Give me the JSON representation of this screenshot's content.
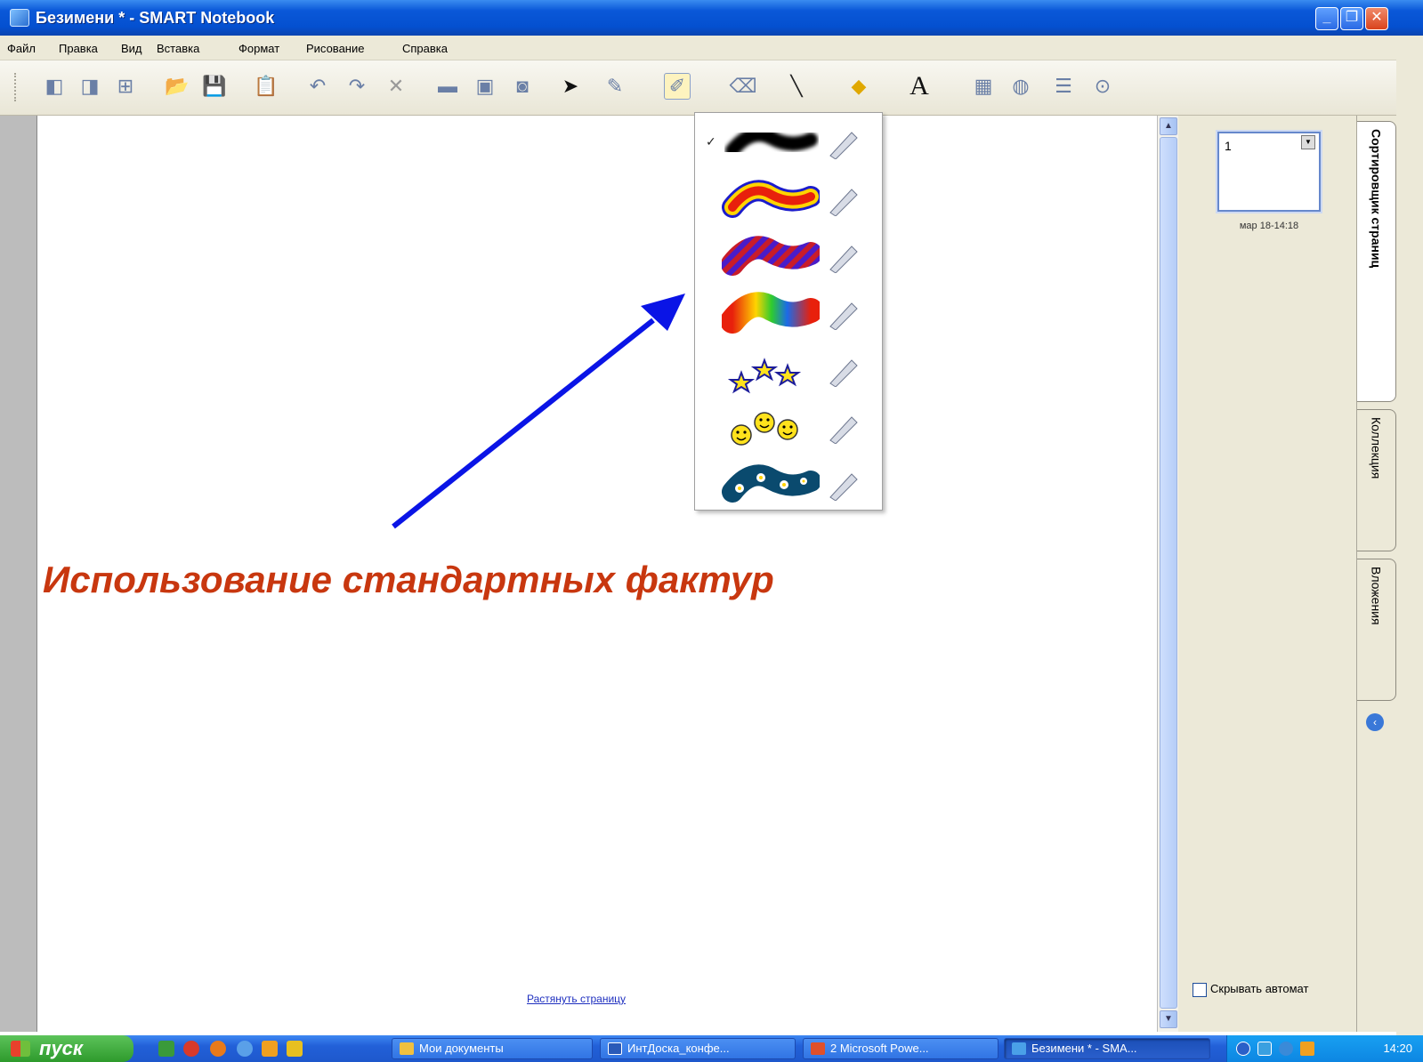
{
  "window": {
    "title": "Безимени * - SMART Notebook"
  },
  "menu": [
    "Файл",
    "Правка",
    "Вид",
    "Вставка",
    "Формат",
    "Рисование",
    "Справка"
  ],
  "toolbar": {
    "icons": [
      "previous-page-icon",
      "next-page-icon",
      "add-page-icon",
      "open-icon",
      "save-icon",
      "paste-icon",
      "undo-icon",
      "redo-icon",
      "delete-icon",
      "screen-shade-icon",
      "full-screen-icon",
      "screen-capture-icon",
      "select-icon",
      "pen-icon",
      "creative-pen-icon",
      "eraser-icon",
      "line-icon",
      "shapes-icon",
      "text-icon",
      "fill-icon",
      "properties-icon",
      "more-icon",
      "help-icon"
    ]
  },
  "pen_popup": {
    "items": [
      {
        "name": "black-brush-stroke",
        "selected": true,
        "check": "✓"
      },
      {
        "name": "rainbow-outline-stroke",
        "selected": false
      },
      {
        "name": "striped-stroke",
        "selected": false
      },
      {
        "name": "rainbow-gradient-stroke",
        "selected": false
      },
      {
        "name": "stars-stroke",
        "selected": false
      },
      {
        "name": "smileys-stroke",
        "selected": false
      },
      {
        "name": "flowers-stroke",
        "selected": false
      }
    ]
  },
  "canvas": {
    "caption": "Использование стандартных фактур",
    "stretch_link": "Растянуть страницу",
    "arrow_color": "#0a14e6"
  },
  "side_panel": {
    "page_number": "1",
    "page_date": "мар 18-14:18",
    "autohide_label": "Скрывать автомат",
    "tabs": [
      "Сортировщик страниц",
      "Коллекция",
      "Вложения"
    ]
  },
  "taskbar": {
    "start_label": "пуск",
    "tasks": [
      "Мои документы",
      "ИнтДоска_конфе...",
      "2 Microsoft Powe...",
      "Безимени * - SMA..."
    ],
    "clock": "14:20"
  }
}
